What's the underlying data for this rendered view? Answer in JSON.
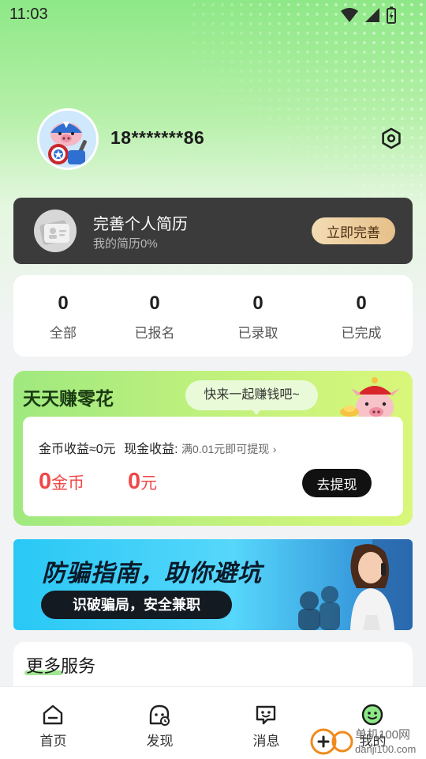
{
  "status_bar": {
    "time": "11:03"
  },
  "profile": {
    "username": "18*******86"
  },
  "resume": {
    "title": "完善个人简历",
    "subtitle": "我的简历0%",
    "progress_percent": 0,
    "button_label": "立即完善"
  },
  "stats": [
    {
      "value": "0",
      "label": "全部"
    },
    {
      "value": "0",
      "label": "已报名"
    },
    {
      "value": "0",
      "label": "已录取"
    },
    {
      "value": "0",
      "label": "已完成"
    }
  ],
  "earn": {
    "title": "天天赚零花",
    "bubble": "快来一起赚钱吧~",
    "coin_income_label": "金币收益≈0元",
    "cash_income_label": "现金收益:",
    "cash_hint": "满0.01元即可提现",
    "coin_amount": "0",
    "coin_unit": "金币",
    "cash_amount": "0",
    "cash_unit": "元",
    "withdraw_label": "去提现"
  },
  "banner": {
    "title": "防骗指南，助你避坑",
    "subtitle": "识破骗局，安全兼职"
  },
  "more_services": {
    "title": "更多服务"
  },
  "nav": [
    {
      "label": "首页",
      "icon": "home-icon"
    },
    {
      "label": "发现",
      "icon": "discover-icon"
    },
    {
      "label": "消息",
      "icon": "message-icon"
    },
    {
      "label": "我的",
      "icon": "profile-smile-icon",
      "active": true
    }
  ],
  "watermark": {
    "text": "danji100.com",
    "brand": "单机100网"
  },
  "colors": {
    "accent_green": "#8ee887",
    "dark_card": "#3b3b3b",
    "money_red": "#f04848",
    "gold_button": "#e6c08a",
    "banner_blue": "#29c8f5"
  }
}
